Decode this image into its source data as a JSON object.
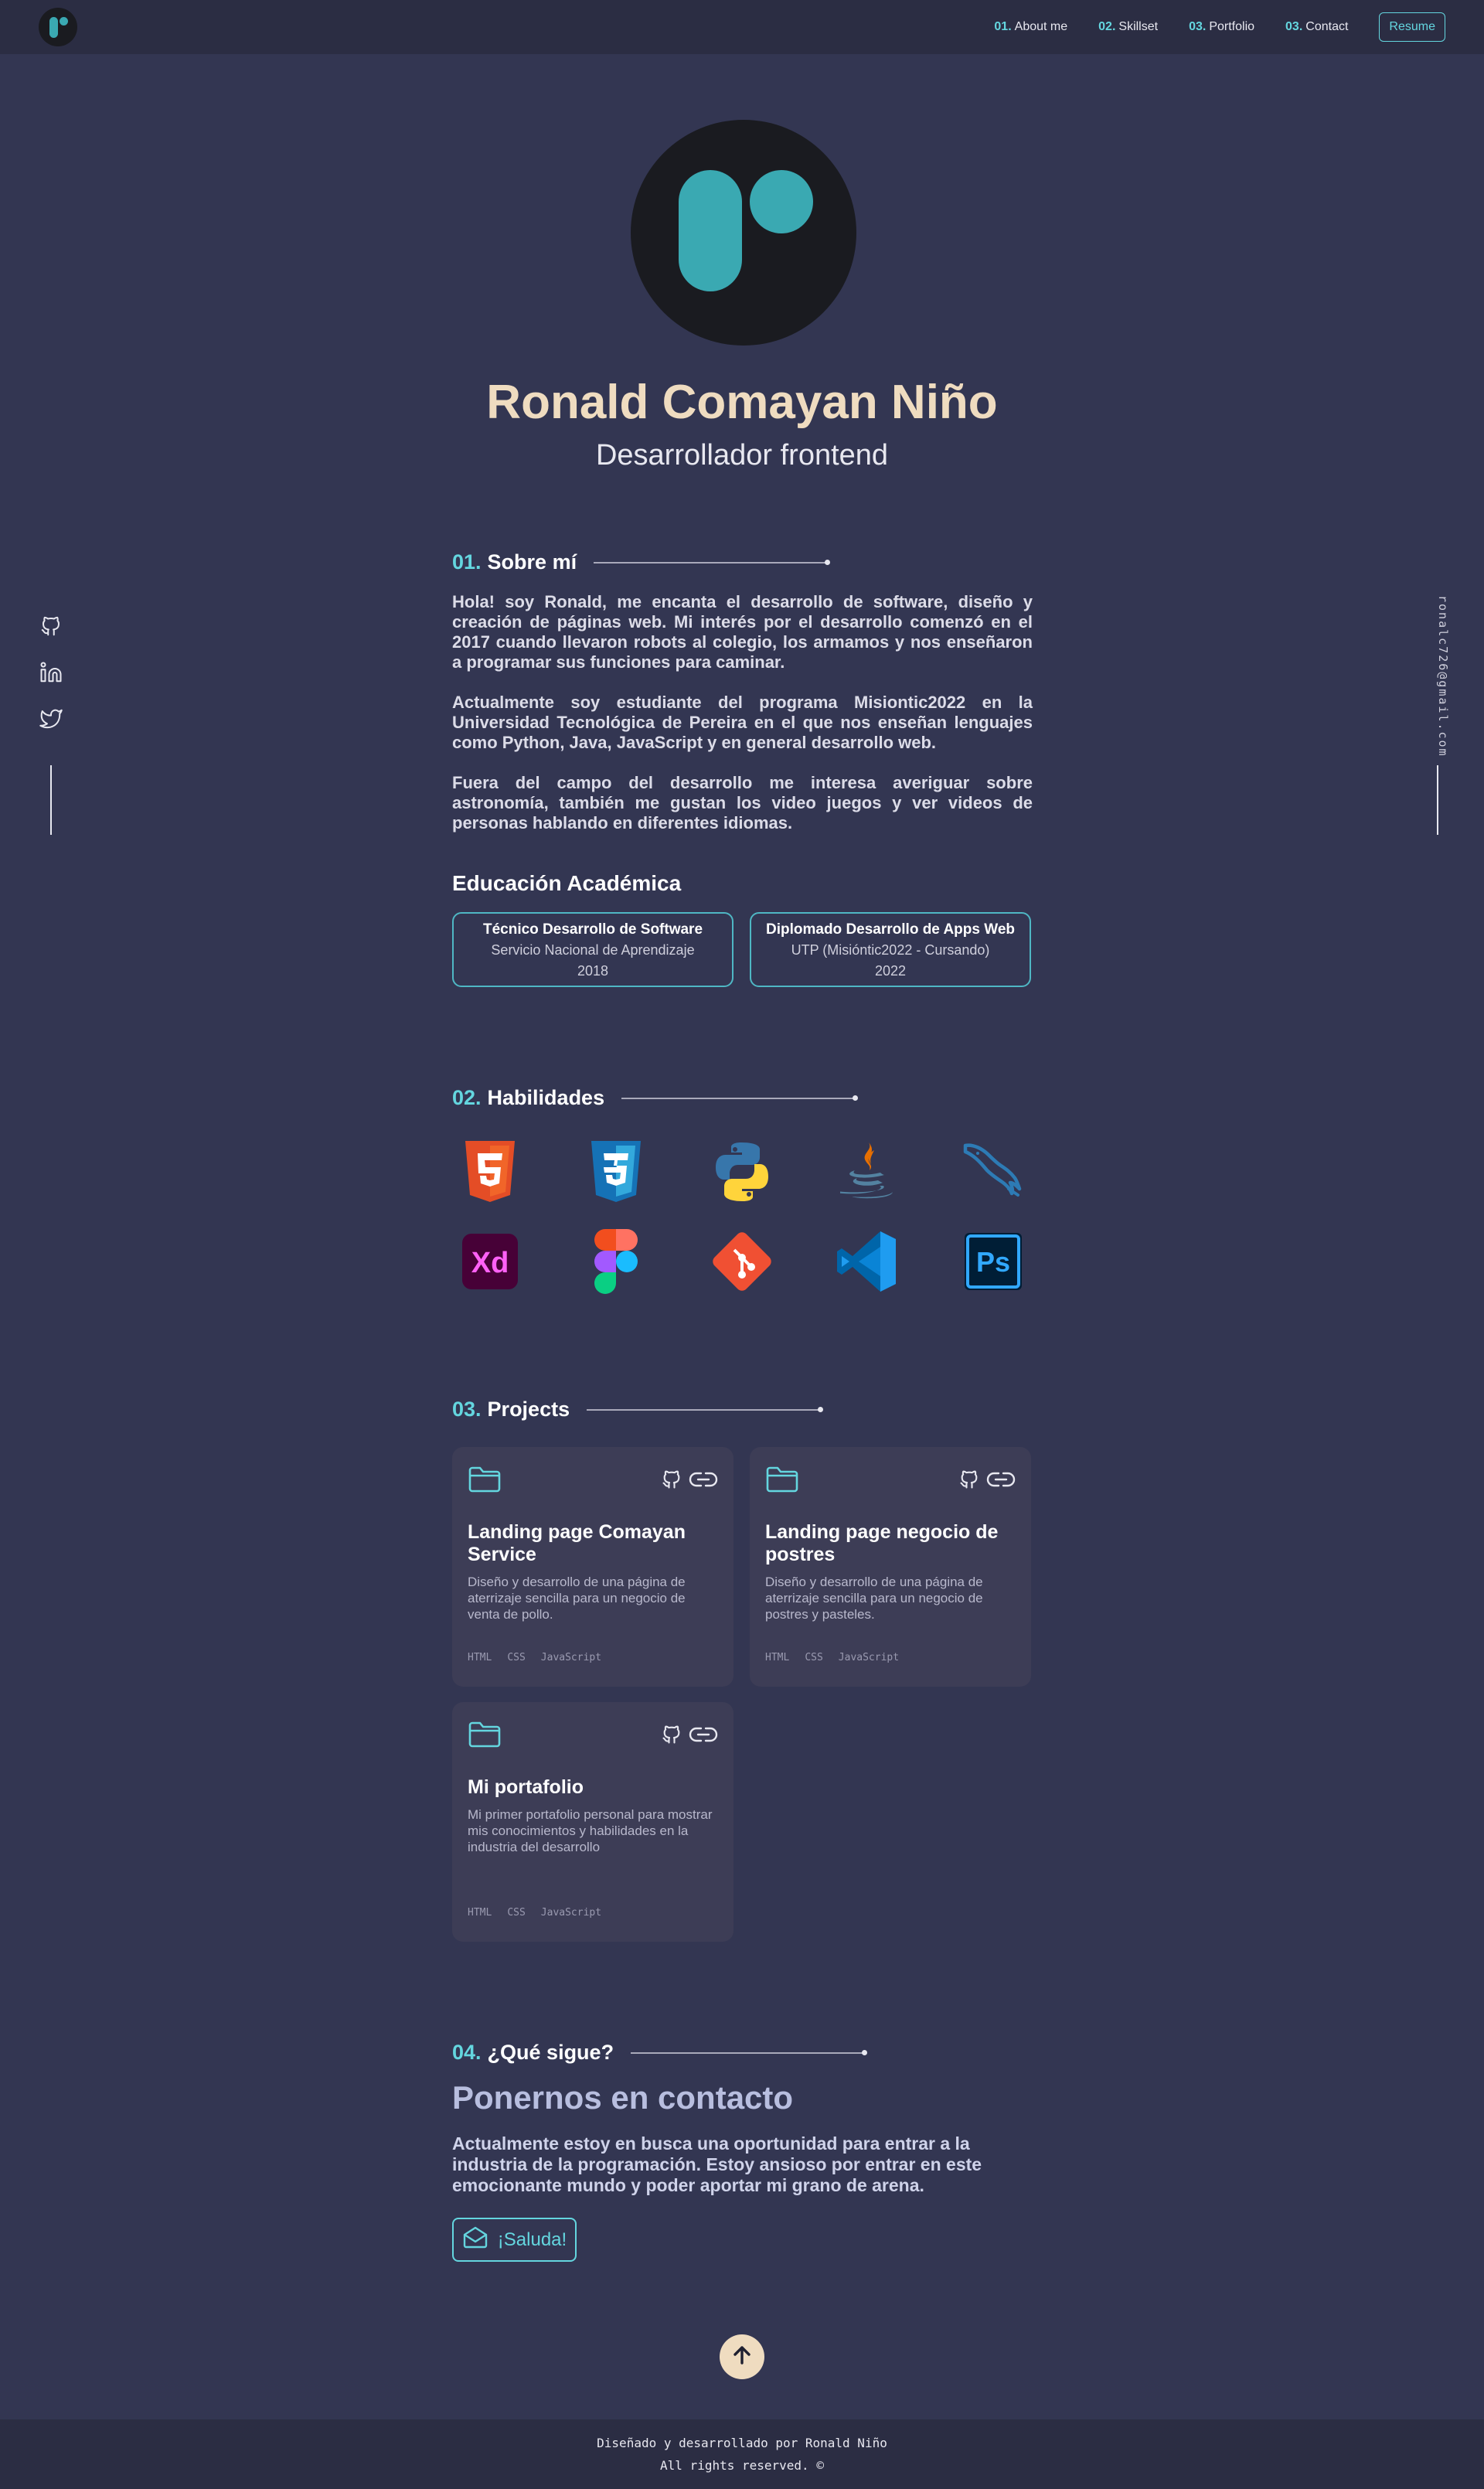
{
  "nav": {
    "logo_icon": "rc-logo-icon",
    "links": [
      {
        "num": "01.",
        "label": "About me"
      },
      {
        "num": "02.",
        "label": "Skillset"
      },
      {
        "num": "03.",
        "label": "Portfolio"
      },
      {
        "num": "03.",
        "label": "Contact"
      }
    ],
    "resume_label": "Resume"
  },
  "hero": {
    "name": "Ronald Comayan Niño",
    "role": "Desarrollador frontend"
  },
  "social": {
    "icons": [
      "github-icon",
      "linkedin-icon",
      "twitter-icon"
    ],
    "email": "ronalc726@gmail.com"
  },
  "about": {
    "num": "01.",
    "title": "Sobre mí",
    "paragraphs": [
      "Hola! soy Ronald, me encanta el desarrollo de software, diseño y creación de páginas web. Mi interés por el desarrollo comenzó en el 2017 cuando llevaron robots al colegio, los armamos y nos enseñaron a programar sus funciones para caminar.",
      "Actualmente soy estudiante del programa Misiontic2022 en la Universidad Tecnológica de Pereira en el que nos enseñan lenguajes como Python, Java, JavaScript y en general desarrollo web.",
      "Fuera del campo del desarrollo me interesa averiguar sobre astronomía, también me gustan los video juegos y ver videos de personas hablando en diferentes idiomas."
    ],
    "education_title": "Educación Académica",
    "education": [
      {
        "title": "Técnico Desarrollo de Software",
        "school": "Servicio Nacional de Aprendizaje",
        "year": "2018"
      },
      {
        "title": "Diplomado Desarrollo de Apps Web",
        "school": "UTP (Misióntic2022 - Cursando)",
        "year": "2022"
      }
    ]
  },
  "skills": {
    "num": "02.",
    "title": "Habilidades",
    "icons": [
      "html5-icon",
      "css3-icon",
      "python-icon",
      "java-icon",
      "mysql-icon",
      "adobe-xd-icon",
      "figma-icon",
      "git-icon",
      "vscode-icon",
      "photoshop-icon"
    ]
  },
  "projects": {
    "num": "03.",
    "title": "Projects",
    "items": [
      {
        "title": "Landing page Comayan Service",
        "desc": "Diseño y desarrollo de una página de aterrizaje sencilla para un negocio de venta de pollo.",
        "tags": [
          "HTML",
          "CSS",
          "JavaScript"
        ]
      },
      {
        "title": "Landing page negocio de postres",
        "desc": "Diseño y desarrollo de una página de aterrizaje sencilla para un negocio de postres y pasteles.",
        "tags": [
          "HTML",
          "CSS",
          "JavaScript"
        ]
      },
      {
        "title": "Mi portafolio",
        "desc": "Mi primer portafolio personal para mostrar mis conocimientos y habilidades en la industria del desarrollo",
        "tags": [
          "HTML",
          "CSS",
          "JavaScript"
        ]
      }
    ]
  },
  "contact": {
    "num": "04.",
    "title": "¿Qué sigue?",
    "heading": "Ponernos en contacto",
    "text": "Actualmente estoy en busca una oportunidad para entrar a la industria de la programación. Estoy ansioso por entrar en este emocionante mundo y poder aportar mi grano de arena.",
    "button_label": "¡Saluda!"
  },
  "footer": {
    "line1": "Diseñado y desarrollado por Ronald Niño",
    "line2": "All rights reserved. ©"
  },
  "colors": {
    "background": "#333652",
    "nav_bg": "#2b2d43",
    "accent": "#64d6df",
    "name": "#efdcc0",
    "card": "#3d3d56"
  }
}
